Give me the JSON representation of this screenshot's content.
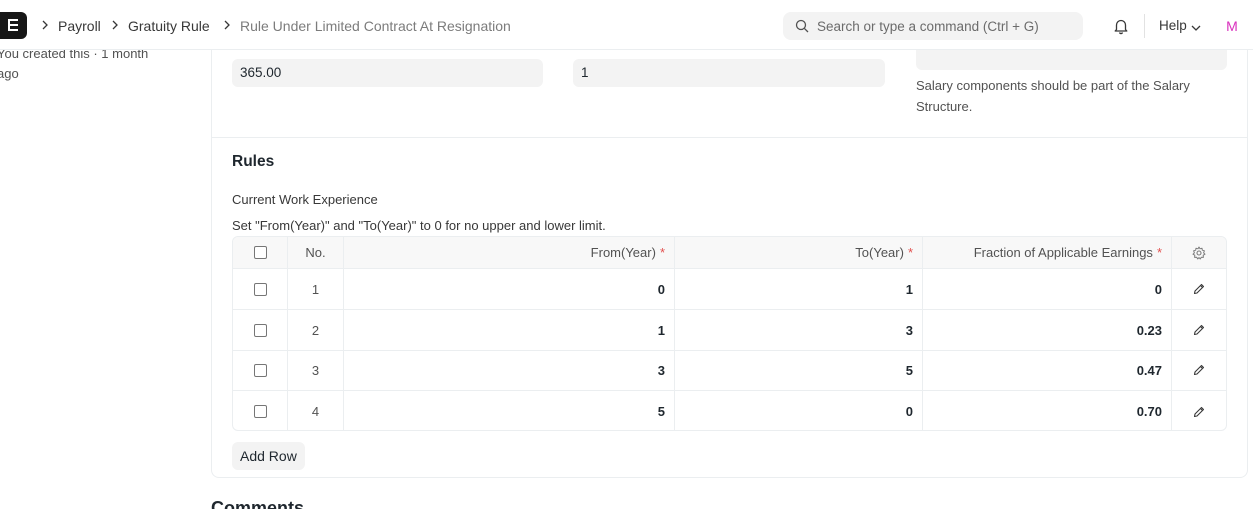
{
  "navbar": {
    "breadcrumbs": [
      "Payroll",
      "Gratuity Rule",
      "Rule Under Limited Contract At Resignation"
    ],
    "search_placeholder": "Search or type a command (Ctrl + G)",
    "help_label": "Help",
    "avatar_letter": "M"
  },
  "sidebar": {
    "created_text": "You created this · 1 month ago"
  },
  "form": {
    "field1_value": "365.00",
    "field2_value": "1",
    "salary_components_note": "Salary components should be part of the Salary Structure."
  },
  "rules_section": {
    "title": "Rules",
    "field_label": "Current Work Experience",
    "field_description": "Set \"From(Year)\" and \"To(Year)\" to 0 for no upper and lower limit.",
    "columns": {
      "no": "No.",
      "from_year": "From(Year)",
      "to_year": "To(Year)",
      "fraction": "Fraction of Applicable Earnings",
      "required_mark": "*"
    },
    "rows": [
      {
        "no": "1",
        "from_year": "0",
        "to_year": "1",
        "fraction": "0"
      },
      {
        "no": "2",
        "from_year": "1",
        "to_year": "3",
        "fraction": "0.23"
      },
      {
        "no": "3",
        "from_year": "3",
        "to_year": "5",
        "fraction": "0.47"
      },
      {
        "no": "4",
        "from_year": "5",
        "to_year": "0",
        "fraction": "0.70"
      }
    ],
    "add_row_label": "Add Row"
  },
  "comments": {
    "heading": "Comments"
  }
}
